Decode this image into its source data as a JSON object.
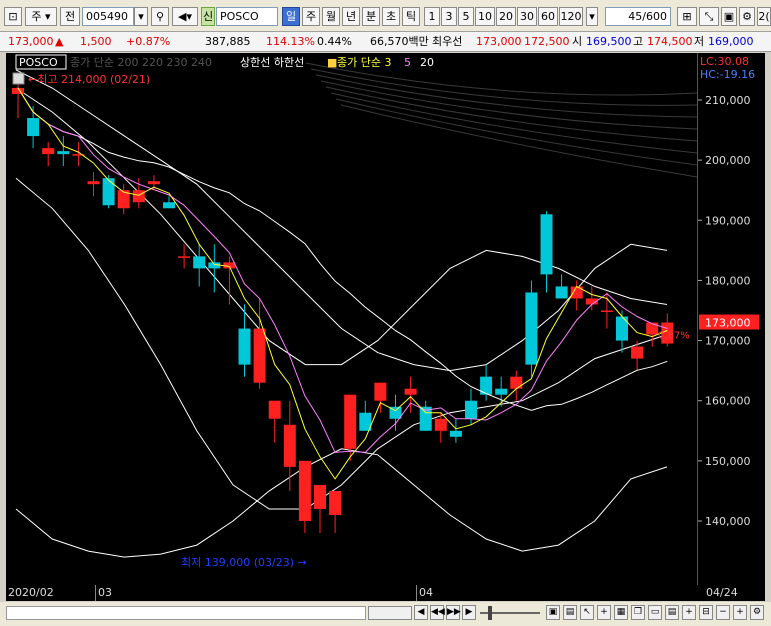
{
  "toolbar": {
    "period_label": "주",
    "prev_label": "전",
    "stock_code": "005490",
    "stock_name": "POSCO",
    "market_badge": "신",
    "period_buttons": [
      "일",
      "주",
      "월",
      "년",
      "분",
      "초",
      "틱"
    ],
    "interval_buttons": [
      "1",
      "3",
      "5",
      "10",
      "20",
      "30",
      "60",
      "120"
    ],
    "count_value": "45",
    "count_total": "/600",
    "right_partial": "2("
  },
  "price_bar": {
    "price": "173,000",
    "change": "1,500",
    "change_pct": "+0.87%",
    "volume": "387,885",
    "volume_ratio": "114.13%",
    "turnover": "0.44%",
    "amount": "66,570백만",
    "ask_label": "최우선",
    "ask": "173,000",
    "bid": "172,500",
    "open_label": "시",
    "open": "169,500",
    "high_label": "고",
    "high": "174,500",
    "low_label": "저",
    "low": "169,000"
  },
  "chart": {
    "stock_name": "POSCO",
    "legend_faded": "종가 단순 200 220 230 240",
    "legend_limits": "상한선  하한선",
    "legend_ma": "종가 단순 3",
    "legend_ma_periods": [
      "5",
      "20"
    ],
    "max_marker": "최고 214,000 (02/21)",
    "min_marker": "최저 139,000 (03/23)",
    "lc_label": "LC:30.08",
    "hc_label": "HC:-19.16",
    "current_price_tag": "173,000",
    "current_pct_tag": "0.87%",
    "colors": {
      "up": "#ff2020",
      "down": "#00c8d8",
      "ma3": "#ffff30",
      "ma5": "#ff80ff",
      "ma20": "#ffffff"
    }
  },
  "chart_data": {
    "type": "candlestick",
    "y_ticks": [
      "210,000",
      "200,000",
      "190,000",
      "180,000",
      "170,000",
      "160,000",
      "150,000",
      "140,000"
    ],
    "ylim": [
      134000,
      215000
    ],
    "x_labels": [
      "2020/02",
      "03",
      "04",
      "04/24"
    ],
    "candles": [
      {
        "o": 211000,
        "h": 214000,
        "l": 207000,
        "c": 212000
      },
      {
        "o": 207000,
        "h": 209000,
        "l": 202000,
        "c": 204000
      },
      {
        "o": 201000,
        "h": 203000,
        "l": 199000,
        "c": 202000
      },
      {
        "o": 201500,
        "h": 204000,
        "l": 199000,
        "c": 201000
      },
      {
        "o": 201000,
        "h": 203000,
        "l": 199000,
        "c": 201000
      },
      {
        "o": 196000,
        "h": 198000,
        "l": 194000,
        "c": 196500
      },
      {
        "o": 197000,
        "h": 197500,
        "l": 192000,
        "c": 192500
      },
      {
        "o": 192000,
        "h": 196000,
        "l": 191000,
        "c": 195000
      },
      {
        "o": 193000,
        "h": 197000,
        "l": 192000,
        "c": 195000
      },
      {
        "o": 196000,
        "h": 197500,
        "l": 195000,
        "c": 196500
      },
      {
        "o": 193000,
        "h": 194000,
        "l": 192000,
        "c": 192000
      },
      {
        "o": 184000,
        "h": 186000,
        "l": 182000,
        "c": 184000
      },
      {
        "o": 184000,
        "h": 186000,
        "l": 179000,
        "c": 182000
      },
      {
        "o": 183000,
        "h": 186000,
        "l": 178000,
        "c": 182000
      },
      {
        "o": 182000,
        "h": 184000,
        "l": 176000,
        "c": 183000
      },
      {
        "o": 172000,
        "h": 176000,
        "l": 164000,
        "c": 166000
      },
      {
        "o": 163000,
        "h": 177000,
        "l": 162000,
        "c": 172000
      },
      {
        "o": 157000,
        "h": 160000,
        "l": 153000,
        "c": 160000
      },
      {
        "o": 149000,
        "h": 160000,
        "l": 145000,
        "c": 156000
      },
      {
        "o": 140000,
        "h": 150000,
        "l": 138000,
        "c": 150000
      },
      {
        "o": 142000,
        "h": 146000,
        "l": 138000,
        "c": 146000
      },
      {
        "o": 141000,
        "h": 145000,
        "l": 138000,
        "c": 145000
      },
      {
        "o": 152000,
        "h": 161000,
        "l": 150000,
        "c": 161000
      },
      {
        "o": 158000,
        "h": 160000,
        "l": 155000,
        "c": 155000
      },
      {
        "o": 160000,
        "h": 163000,
        "l": 158000,
        "c": 163000
      },
      {
        "o": 159000,
        "h": 161000,
        "l": 155000,
        "c": 157000
      },
      {
        "o": 161000,
        "h": 164000,
        "l": 158000,
        "c": 162000
      },
      {
        "o": 159000,
        "h": 160000,
        "l": 155000,
        "c": 155000
      },
      {
        "o": 155000,
        "h": 158000,
        "l": 153000,
        "c": 157000
      },
      {
        "o": 155000,
        "h": 157000,
        "l": 153000,
        "c": 154000
      },
      {
        "o": 160000,
        "h": 162000,
        "l": 156000,
        "c": 157000
      },
      {
        "o": 164000,
        "h": 166000,
        "l": 160000,
        "c": 161000
      },
      {
        "o": 162000,
        "h": 164000,
        "l": 159000,
        "c": 161000
      },
      {
        "o": 162000,
        "h": 165000,
        "l": 160000,
        "c": 164000
      },
      {
        "o": 178000,
        "h": 180000,
        "l": 164000,
        "c": 166000
      },
      {
        "o": 191000,
        "h": 191500,
        "l": 178000,
        "c": 181000
      },
      {
        "o": 179000,
        "h": 181000,
        "l": 177000,
        "c": 177000
      },
      {
        "o": 177000,
        "h": 180000,
        "l": 175000,
        "c": 179000
      },
      {
        "o": 176000,
        "h": 179000,
        "l": 175000,
        "c": 177000
      },
      {
        "o": 175000,
        "h": 178000,
        "l": 172000,
        "c": 175000
      },
      {
        "o": 174000,
        "h": 175000,
        "l": 168000,
        "c": 170000
      },
      {
        "o": 167000,
        "h": 170000,
        "l": 165000,
        "c": 169000
      },
      {
        "o": 171000,
        "h": 173000,
        "l": 169000,
        "c": 173000
      },
      {
        "o": 169500,
        "h": 174500,
        "l": 169000,
        "c": 173000
      }
    ],
    "envelope_upper": [
      215000,
      212000,
      208000,
      204000,
      200000,
      196000,
      190000,
      184000,
      178000,
      172000,
      168000,
      166000,
      165000,
      166000,
      170000,
      175000,
      182000,
      186000,
      185000
    ],
    "envelope_lower": [
      142000,
      137000,
      135000,
      134000,
      134500,
      136000,
      140000,
      145000,
      149000,
      152000,
      151000,
      146000,
      141000,
      137000,
      135000,
      136000,
      140000,
      147000,
      149000
    ],
    "band_upper": [
      212000,
      208000,
      203000,
      197000,
      191000,
      184000,
      177000,
      170000,
      166000,
      166000,
      170000,
      176000,
      182000,
      185000,
      184000,
      182000,
      179000,
      177000,
      176000
    ],
    "band_lower": [
      197000,
      192000,
      185000,
      176000,
      166000,
      155000,
      146000,
      142000,
      142000,
      146000,
      152000,
      156000,
      158000,
      159000,
      160000,
      163000,
      167000,
      169000,
      171000
    ]
  },
  "bottombar": {
    "buttons": [
      "◀",
      "◀◀",
      "▶▶",
      "▶"
    ]
  }
}
